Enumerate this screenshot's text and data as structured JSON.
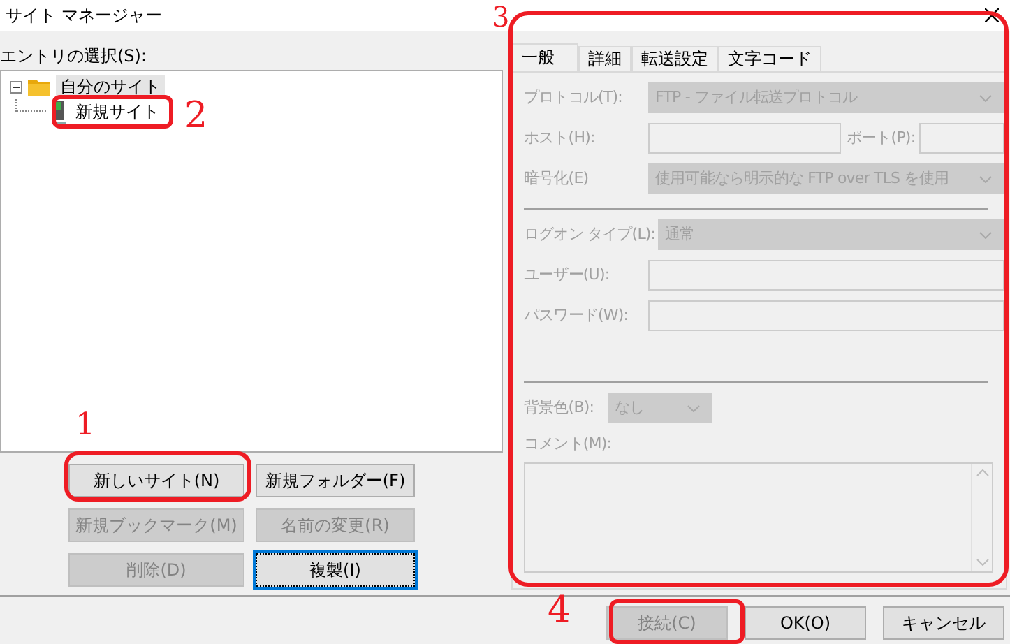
{
  "window": {
    "title": "サイト マネージャー"
  },
  "entry_label": "エントリの選択(S):",
  "tree": [
    {
      "label": "自分のサイト",
      "kind": "folder",
      "expanded": true,
      "selected": true,
      "children": [
        {
          "label": "新規サイト",
          "kind": "site",
          "selected": false
        }
      ]
    }
  ],
  "site_buttons": [
    {
      "label": "新しいサイト(N)",
      "disabled": false,
      "focused": false
    },
    {
      "label": "新規フォルダー(F)",
      "disabled": false,
      "focused": false
    },
    {
      "label": "新規ブックマーク(M)",
      "disabled": true,
      "focused": false
    },
    {
      "label": "名前の変更(R)",
      "disabled": true,
      "focused": false
    },
    {
      "label": "削除(D)",
      "disabled": true,
      "focused": false
    },
    {
      "label": "複製(I)",
      "disabled": false,
      "focused": true
    }
  ],
  "tabs": [
    {
      "label": "一般",
      "selected": true
    },
    {
      "label": "詳細",
      "selected": false
    },
    {
      "label": "転送設定",
      "selected": false
    },
    {
      "label": "文字コード",
      "selected": false
    }
  ],
  "general": {
    "disabled": true,
    "fields": [
      {
        "kind": "dropdown",
        "label": "プロトコル(T):",
        "value": "FTP - ファイル転送プロトコル"
      },
      {
        "kind": "host",
        "label": "ホスト(H):",
        "port_label": "ポート(P):"
      },
      {
        "kind": "dropdown",
        "label": "暗号化(E)",
        "value": "使用可能なら明示的な FTP over TLS を使用"
      },
      {
        "kind": "separator"
      },
      {
        "kind": "dropdown",
        "label": "ログオン タイプ(L):",
        "value": "通常"
      },
      {
        "kind": "text",
        "label": "ユーザー(U):"
      },
      {
        "kind": "text",
        "label": "パスワード(W):"
      }
    ],
    "background_color": {
      "label": "背景色(B):",
      "value": "なし"
    },
    "comment": {
      "label": "コメント(M):"
    }
  },
  "dialog_buttons": [
    {
      "label": "接続(C)",
      "disabled": true
    },
    {
      "label": "OK(O)",
      "disabled": false
    },
    {
      "label": "キャンセル",
      "disabled": false
    }
  ],
  "annotations": [
    {
      "number": "1"
    },
    {
      "number": "2"
    },
    {
      "number": "3"
    },
    {
      "number": "4"
    }
  ]
}
